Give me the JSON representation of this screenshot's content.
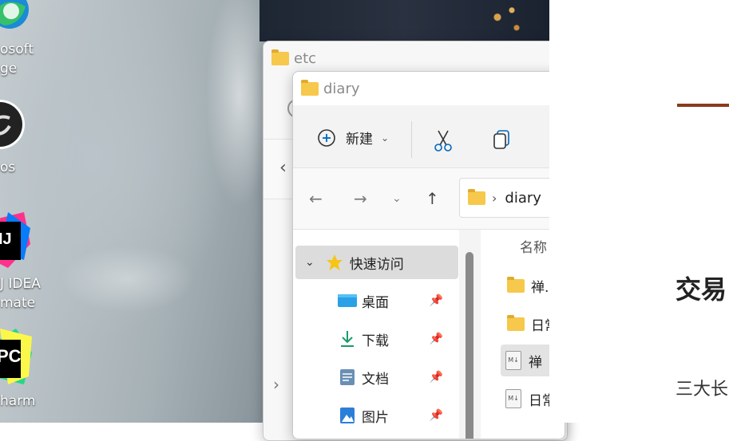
{
  "desktop": {
    "icons": [
      {
        "label1": "osoft",
        "label2": "ge",
        "icon": "edge-icon"
      },
      {
        "label1": "os",
        "icon": "obs-icon"
      },
      {
        "label1": "J IDEA",
        "label2": "mate",
        "icon": "intellij-icon"
      },
      {
        "label1": "harm",
        "icon": "pycharm-icon"
      }
    ]
  },
  "window_back": {
    "title": "etc"
  },
  "window_front": {
    "title": "diary",
    "toolbar": {
      "new_label": "新建"
    },
    "address": {
      "path_current": "diary"
    },
    "nav": {
      "items": [
        {
          "label": "快速访问",
          "icon": "star-icon"
        },
        {
          "label": "桌面",
          "icon": "desktop-icon"
        },
        {
          "label": "下载",
          "icon": "download-icon"
        },
        {
          "label": "文档",
          "icon": "document-icon"
        },
        {
          "label": "图片",
          "icon": "pictures-icon"
        }
      ]
    },
    "files": {
      "column_name": "名称",
      "rows": [
        {
          "name": "禅.a",
          "type": "folder"
        },
        {
          "name": "日常",
          "type": "folder"
        },
        {
          "name": "禅",
          "type": "markdown"
        },
        {
          "name": "日常",
          "type": "markdown"
        }
      ]
    }
  },
  "document": {
    "heading": "交易",
    "body": "三大长"
  },
  "colors": {
    "folder": "#f6c84b",
    "accent": "#0067c0"
  }
}
